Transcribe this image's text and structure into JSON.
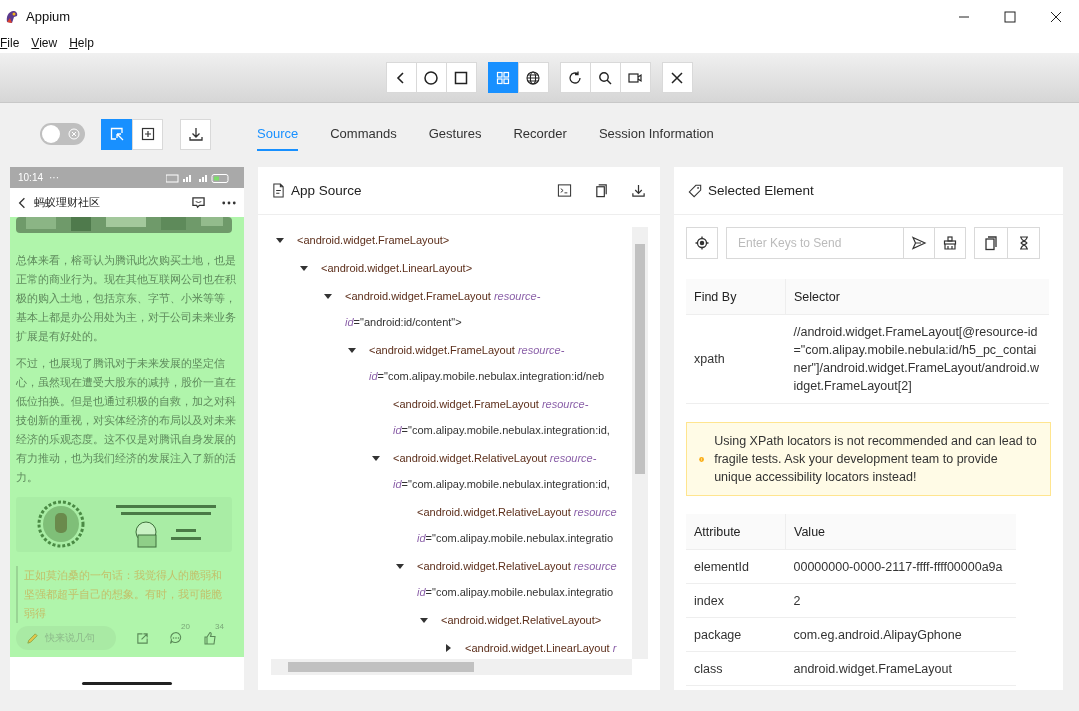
{
  "window": {
    "title": "Appium"
  },
  "menu": [
    "File",
    "View",
    "Help"
  ],
  "toolbar": {
    "groups": [
      {
        "buttons": [
          {
            "kind": "back",
            "selected": false
          },
          {
            "kind": "home",
            "selected": false
          },
          {
            "kind": "apps",
            "selected": false
          }
        ]
      },
      {
        "buttons": [
          {
            "kind": "native",
            "selected": true
          },
          {
            "kind": "web",
            "selected": false
          }
        ]
      },
      {
        "buttons": [
          {
            "kind": "refresh",
            "selected": false
          },
          {
            "kind": "search",
            "selected": false
          },
          {
            "kind": "record",
            "selected": false
          }
        ]
      },
      {
        "buttons": [
          {
            "kind": "close",
            "selected": false
          }
        ]
      }
    ]
  },
  "inspector": {
    "toggle_on": false,
    "modes": [
      {
        "kind": "select",
        "selected": true
      },
      {
        "kind": "tap",
        "selected": false
      }
    ],
    "download": {
      "kind": "download"
    }
  },
  "tabs": [
    {
      "label": "Source",
      "selected": true
    },
    {
      "label": "Commands",
      "selected": false
    },
    {
      "label": "Gestures",
      "selected": false
    },
    {
      "label": "Recorder",
      "selected": false
    },
    {
      "label": "Session Information",
      "selected": false
    }
  ],
  "device": {
    "time": "10:14",
    "more": "···",
    "title": "蚂蚁理财社区",
    "paragraphs": [
      "总体来看，榕哥认为腾讯此次购买土地，也是正常的商业行为。现在其他互联网公司也在积极的购入土地，包括京东、字节、小米等等，基本上都是办公用处为主，对于公司未来业务扩展是有好处的。",
      "不过，也展现了腾讯对于未来发展的坚定信心，虽然现在遭受大股东的减持，股价一直在低位拍换。但是也通过积极的自救，加之对科技创新的重视，对实体经济的布局以及对未来经济的乐观态度。这不仅是对腾讯自身发展的有力推动，也为我们经济的发展注入了新的活力。"
    ],
    "quote": "正如莫泊桑的一句话：我觉得人的脆弱和坚强都超乎自己的想象。有时，我可能脆弱得",
    "comment_placeholder": "快来说几句",
    "comment_count": "20",
    "like_count": "34"
  },
  "app_source": {
    "title": "App Source",
    "tree": [
      {
        "kind": "branch",
        "expanded": true,
        "tag": "<android.widget.FrameLayout>",
        "children": [
          {
            "kind": "branch",
            "expanded": true,
            "tag": "<android.widget.LinearLayout>",
            "children": [
              {
                "kind": "branch",
                "expanded": true,
                "tag": "<android.widget.FrameLayout",
                "attr_head": "resource-",
                "attr_tail": "id",
                "value": "=\"android:id/content\">",
                "children": [
                  {
                    "kind": "branch",
                    "expanded": true,
                    "tag": "<android.widget.FrameLayout",
                    "attr_head": "resource-",
                    "attr_tail": "id",
                    "value": "=\"com.alipay.mobile.nebulax.integration:id/neb",
                    "children": [
                      {
                        "kind": "leaf",
                        "tag": "<android.widget.FrameLayout",
                        "attr_head": "resource-",
                        "attr_tail": "id",
                        "value": "=\"com.alipay.mobile.nebulax.integration:id,"
                      },
                      {
                        "kind": "branch",
                        "expanded": true,
                        "tag": "<android.widget.RelativeLayout",
                        "attr_head": "resource-",
                        "attr_tail": "id",
                        "value": "=\"com.alipay.mobile.nebulax.integration:id,",
                        "children": [
                          {
                            "kind": "leaf",
                            "tag": "<android.widget.RelativeLayout",
                            "attr_head": "resource",
                            "attr_tail": "id",
                            "value": "=\"com.alipay.mobile.nebulax.integratio"
                          },
                          {
                            "kind": "branch",
                            "expanded": true,
                            "tag": "<android.widget.RelativeLayout",
                            "attr_head": "resource",
                            "attr_tail": "id",
                            "value": "=\"com.alipay.mobile.nebulax.integratio",
                            "children": [
                              {
                                "kind": "branch",
                                "expanded": true,
                                "tag": "<android.widget.RelativeLayout>",
                                "children": [
                                  {
                                    "kind": "branch",
                                    "expanded": false,
                                    "tag": "<android.widget.LinearLayout",
                                    "attr_head": "r"
                                  }
                                ]
                              }
                            ]
                          }
                        ]
                      }
                    ]
                  }
                ]
              }
            ]
          }
        ]
      }
    ]
  },
  "selected_element": {
    "title": "Selected Element",
    "keys_placeholder": "Enter Keys to Send",
    "selector_table": {
      "columns": [
        "Find By",
        "Selector"
      ],
      "rows": [
        [
          "xpath",
          "//android.widget.FrameLayout[@resource-id=\"com.alipay.mobile.nebula:id/h5_pc_container\"]/android.widget.FrameLayout/android.widget.FrameLayout[2]"
        ]
      ]
    },
    "warning": "Using XPath locators is not recommended and can lead to fragile tests. Ask your development team to provide unique accessibility locators instead!",
    "attribute_table": {
      "columns": [
        "Attribute",
        "Value"
      ],
      "rows": [
        [
          "elementId",
          "00000000-0000-2117-ffff-ffff00000a9a"
        ],
        [
          "index",
          "2"
        ],
        [
          "package",
          "com.eg.android.AlipayGphone"
        ],
        [
          "class",
          "android.widget.FrameLayout"
        ]
      ]
    }
  }
}
